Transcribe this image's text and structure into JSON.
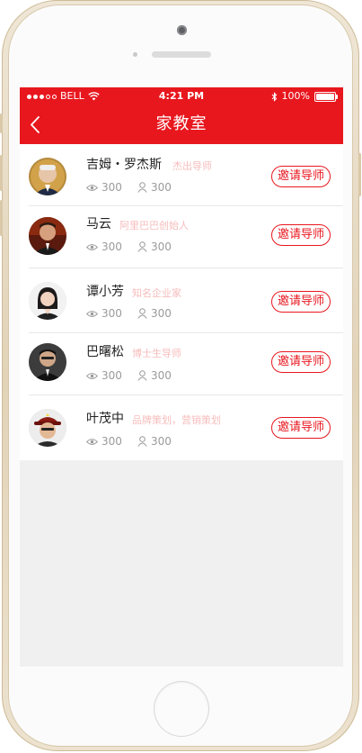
{
  "status_bar": {
    "carrier": "BELL",
    "time": "4:21 PM",
    "battery": "100%",
    "battery_level": 1.0
  },
  "nav": {
    "title": "家教室",
    "back_icon": "chevron-left-icon"
  },
  "colors": {
    "brand": "#e8171e",
    "title_accent": "#f7bcbc",
    "meta": "#9a9a9a"
  },
  "tutors": [
    {
      "name": "吉姆・罗杰斯",
      "title": "杰出导师",
      "views": "300",
      "follows": "300",
      "button": "邀请导师"
    },
    {
      "name": "马云",
      "title": "阿里巴巴创始人",
      "views": "300",
      "follows": "300",
      "button": "邀请导师"
    },
    {
      "name": "谭小芳",
      "title": "知名企业家",
      "views": "300",
      "follows": "300",
      "button": "邀请导师"
    },
    {
      "name": "巴曙松",
      "title": "博士生导师",
      "views": "300",
      "follows": "300",
      "button": "邀请导师"
    },
    {
      "name": "叶茂中",
      "title": "品牌策划，营销策划",
      "views": "300",
      "follows": "300",
      "button": "邀请导师"
    }
  ]
}
